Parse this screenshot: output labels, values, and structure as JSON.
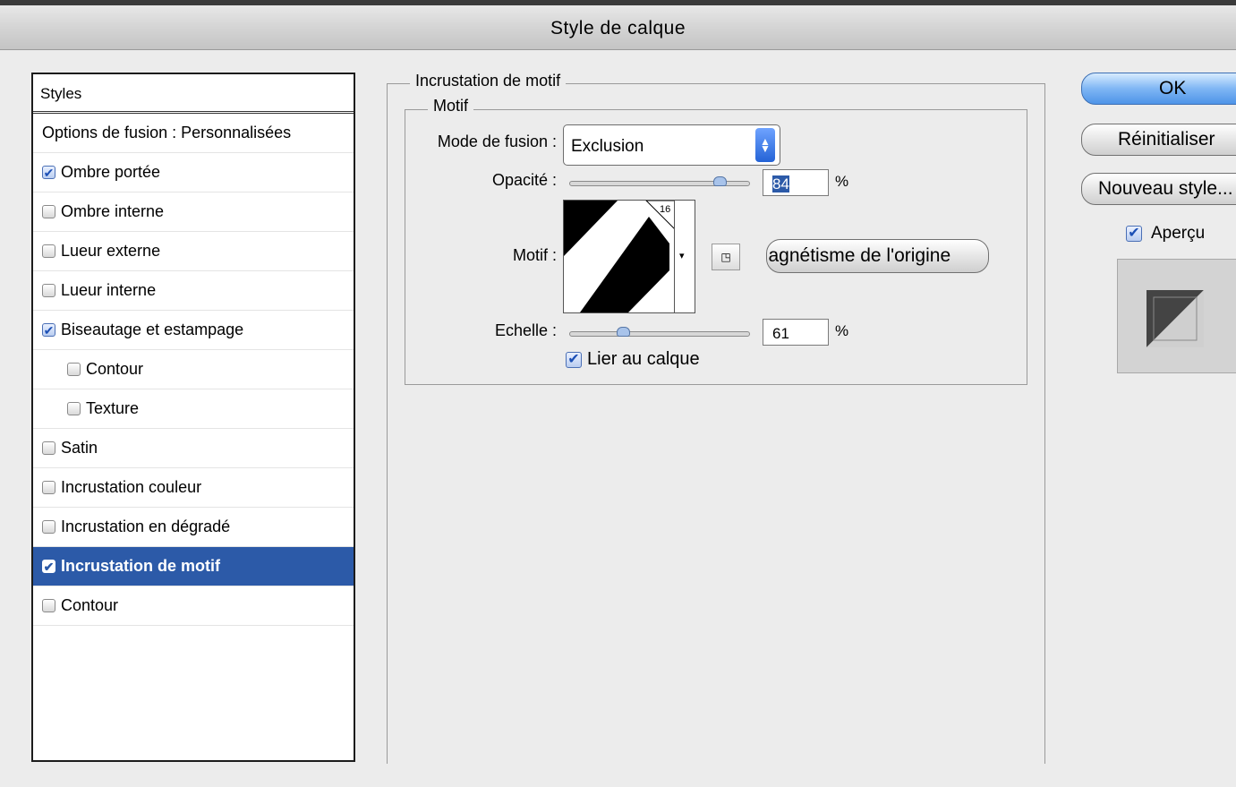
{
  "window": {
    "title": "Style de calque"
  },
  "styles_panel": {
    "header": "Styles",
    "items": [
      {
        "label": "Options de fusion : Personnalisées",
        "checkbox": false,
        "checked": false
      },
      {
        "label": "Ombre portée",
        "checkbox": true,
        "checked": true
      },
      {
        "label": "Ombre interne",
        "checkbox": true,
        "checked": false
      },
      {
        "label": "Lueur externe",
        "checkbox": true,
        "checked": false
      },
      {
        "label": "Lueur interne",
        "checkbox": true,
        "checked": false
      },
      {
        "label": "Biseautage et estampage",
        "checkbox": true,
        "checked": true
      },
      {
        "label": "Contour",
        "checkbox": true,
        "checked": false,
        "indent": true
      },
      {
        "label": "Texture",
        "checkbox": true,
        "checked": false,
        "indent": true
      },
      {
        "label": "Satin",
        "checkbox": true,
        "checked": false
      },
      {
        "label": "Incrustation couleur",
        "checkbox": true,
        "checked": false
      },
      {
        "label": "Incrustation en dégradé",
        "checkbox": true,
        "checked": false
      },
      {
        "label": "Incrustation de motif",
        "checkbox": true,
        "checked": true,
        "selected": true
      },
      {
        "label": "Contour",
        "checkbox": true,
        "checked": false
      }
    ]
  },
  "pattern_overlay": {
    "group_title": "Incrustation de motif",
    "subgroup_title": "Motif",
    "blend_mode_label": "Mode de fusion :",
    "blend_mode_value": "Exclusion",
    "opacity_label": "Opacité :",
    "opacity_value": "84",
    "opacity_unit": "%",
    "opacity_level": 0.84,
    "pattern_label": "Motif :",
    "pattern_count": "16",
    "snap_origin_button": "Magnétisme de l'origine",
    "scale_label": "Echelle :",
    "scale_value": "61",
    "scale_unit": "%",
    "scale_level": 0.3,
    "link_layer_label": "Lier au calque",
    "link_layer_checked": true
  },
  "buttons": {
    "ok": "OK",
    "reset": "Réinitialiser",
    "new_style": "Nouveau style..."
  },
  "preview": {
    "label": "Aperçu",
    "checked": true
  },
  "icons": {
    "check": "✔",
    "dropdown": "▾",
    "select_arrows": "▲▼",
    "pattern_menu": "options-icon"
  }
}
